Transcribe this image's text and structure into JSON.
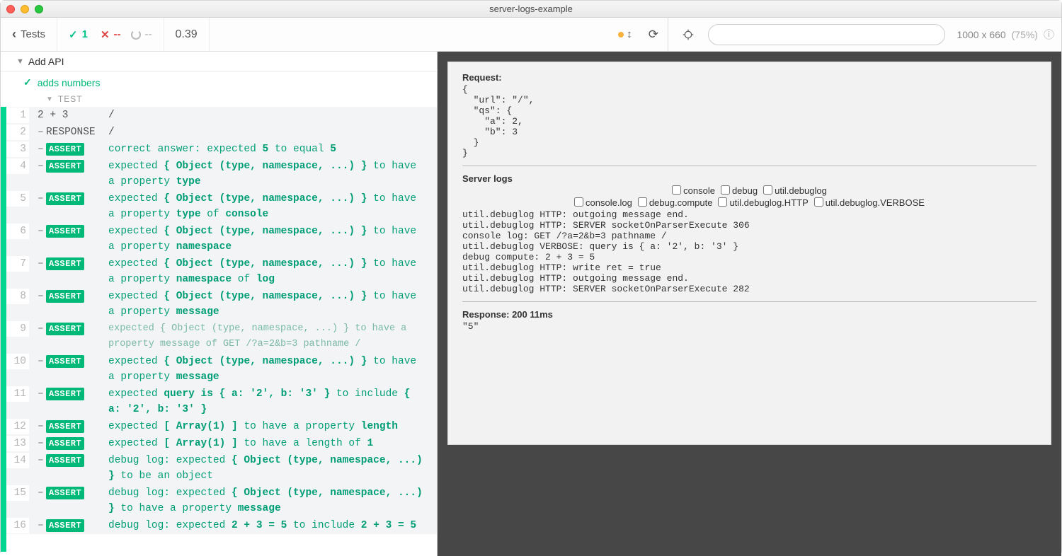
{
  "window": {
    "title": "server-logs-example"
  },
  "toolbar": {
    "back_label": "Tests",
    "pass_count": "1",
    "fail_count": "--",
    "pending_count": "--",
    "duration": "0.39",
    "url_value": "",
    "viewport": "1000 x 660",
    "viewport_pct": "(75%)"
  },
  "suite": {
    "name": "Add API",
    "test_name": "adds numbers",
    "test_section_label": "TEST"
  },
  "log": [
    {
      "n": "1",
      "cmd": "2 + 3",
      "type": "plain",
      "url": "/",
      "msg": ""
    },
    {
      "n": "2",
      "cmd": "RESPONSE",
      "type": "dash-plain",
      "url": "/",
      "msg": ""
    },
    {
      "n": "3",
      "cmd": "ASSERT",
      "type": "assert",
      "msg": "correct answer: expected",
      "tail": " to equal ",
      "b1": "5",
      "b2": "5"
    },
    {
      "n": "4",
      "cmd": "ASSERT",
      "type": "assert-obj",
      "msg": "expected ",
      "obj": "{ Object (type, namespace, ...) }",
      "tail": " to have a property ",
      "b1": "type"
    },
    {
      "n": "5",
      "cmd": "ASSERT",
      "type": "assert-obj",
      "msg": "expected ",
      "obj": "{ Object (type, namespace, ...) }",
      "tail": " to have a property ",
      "b1": "type",
      "of": " of ",
      "b2": "console"
    },
    {
      "n": "6",
      "cmd": "ASSERT",
      "type": "assert-obj",
      "msg": "expected ",
      "obj": "{ Object (type, namespace, ...) }",
      "tail": " to have a property ",
      "b1": "namespace"
    },
    {
      "n": "7",
      "cmd": "ASSERT",
      "type": "assert-obj",
      "msg": "expected ",
      "obj": "{ Object (type, namespace, ...) }",
      "tail": " to have a property ",
      "b1": "namespace",
      "of": " of ",
      "b2": "log"
    },
    {
      "n": "8",
      "cmd": "ASSERT",
      "type": "assert-obj",
      "msg": "expected ",
      "obj": "{ Object (type, namespace, ...) }",
      "tail": " to have a property ",
      "b1": "message"
    },
    {
      "n": "9",
      "cmd": "ASSERT",
      "type": "assert-muted",
      "full": "expected { Object (type, namespace, ...) } to have a property message of GET /?a=2&b=3 pathname /"
    },
    {
      "n": "10",
      "cmd": "ASSERT",
      "type": "assert-obj",
      "msg": "expected ",
      "obj": "{ Object (type, namespace, ...) }",
      "tail": " to have a property ",
      "b1": "message"
    },
    {
      "n": "11",
      "cmd": "ASSERT",
      "type": "assert-obj2",
      "msg": "expected ",
      "obj": "query is { a: '2', b: '3' }",
      "tail": " to include ",
      "obj2": "{ a: '2', b: '3' }"
    },
    {
      "n": "12",
      "cmd": "ASSERT",
      "type": "assert-obj",
      "msg": "expected ",
      "obj": "[ Array(1) ]",
      "tail": " to have a property ",
      "b1": "length"
    },
    {
      "n": "13",
      "cmd": "ASSERT",
      "type": "assert-obj",
      "msg": "expected ",
      "obj": "[ Array(1) ]",
      "tail": " to have a length of ",
      "b1": "1"
    },
    {
      "n": "14",
      "cmd": "ASSERT",
      "type": "assert-obj3",
      "msg": "debug log: expected ",
      "obj": "{ Object (type, namespace, ...) }",
      "tail": " to be an object"
    },
    {
      "n": "15",
      "cmd": "ASSERT",
      "type": "assert-obj",
      "msg": "debug log: expected ",
      "obj": "{ Object (type, namespace, ...) }",
      "tail": " to have a property ",
      "b1": "message"
    },
    {
      "n": "16",
      "cmd": "ASSERT",
      "type": "assert-obj2",
      "msg": "debug log: expected ",
      "obj": "2 + 3 = 5",
      "tail": " to include ",
      "obj2": "2 + 3 = 5"
    }
  ],
  "preview": {
    "request_label": "Request:",
    "request_body": "{\n  \"url\": \"/\",\n  \"qs\": {\n    \"a\": 2,\n    \"b\": 3\n  }\n}",
    "server_logs_label": "Server logs",
    "filters_row1": [
      "console",
      "debug",
      "util.debuglog"
    ],
    "filters_row2": [
      "console.log",
      "debug.compute",
      "util.debuglog.HTTP",
      "util.debuglog.VERBOSE"
    ],
    "log_lines": [
      "util.debuglog HTTP: outgoing message end.",
      "util.debuglog HTTP: SERVER socketOnParserExecute 306",
      "console log: GET /?a=2&b=3 pathname /",
      "util.debuglog VERBOSE: query is { a: '2', b: '3' }",
      "debug compute: 2 + 3 = 5",
      "util.debuglog HTTP: write ret = true",
      "util.debuglog HTTP: outgoing message end.",
      "util.debuglog HTTP: SERVER socketOnParserExecute 282"
    ],
    "response_label": "Response: 200 11ms",
    "response_body": "\"5\""
  }
}
